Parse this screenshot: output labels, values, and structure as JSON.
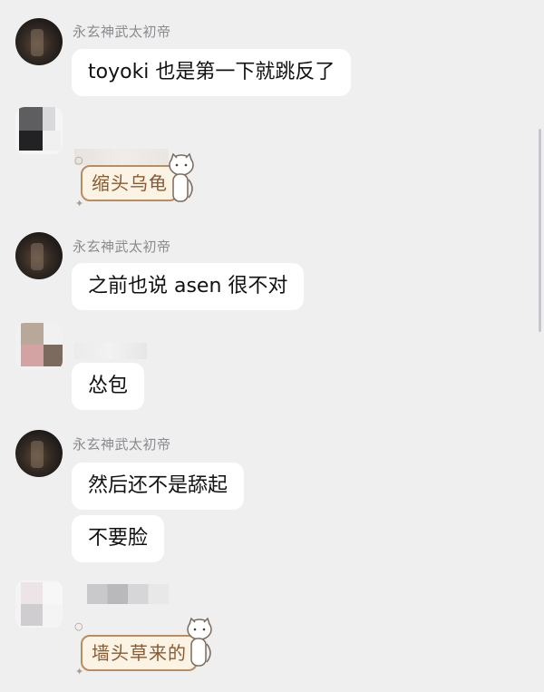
{
  "messages": [
    {
      "sender": "永玄神武太初帝",
      "text": "toyoki 也是第一下就跳反了"
    },
    {
      "sender": "",
      "sticker_text": "缩头乌龟"
    },
    {
      "sender": "永玄神武太初帝",
      "text": "之前也说 asen 很不对"
    },
    {
      "sender": "",
      "text": "怂包"
    },
    {
      "sender": "永玄神武太初帝",
      "text": "然后还不是舔起"
    },
    {
      "sender": "永玄神武太初帝",
      "text": "不要脸"
    },
    {
      "sender": "",
      "sticker_text": "墙头草来的"
    }
  ],
  "colors": {
    "background": "#efeff0",
    "bubble": "#ffffff",
    "sticker_bg": "#fbf3e3",
    "sticker_border": "#b98c62",
    "sticker_text": "#8a5a33",
    "name_text": "#8b8b8f"
  },
  "icons": [
    "avatar",
    "cat-sticker-icon",
    "sparkle-icon"
  ]
}
